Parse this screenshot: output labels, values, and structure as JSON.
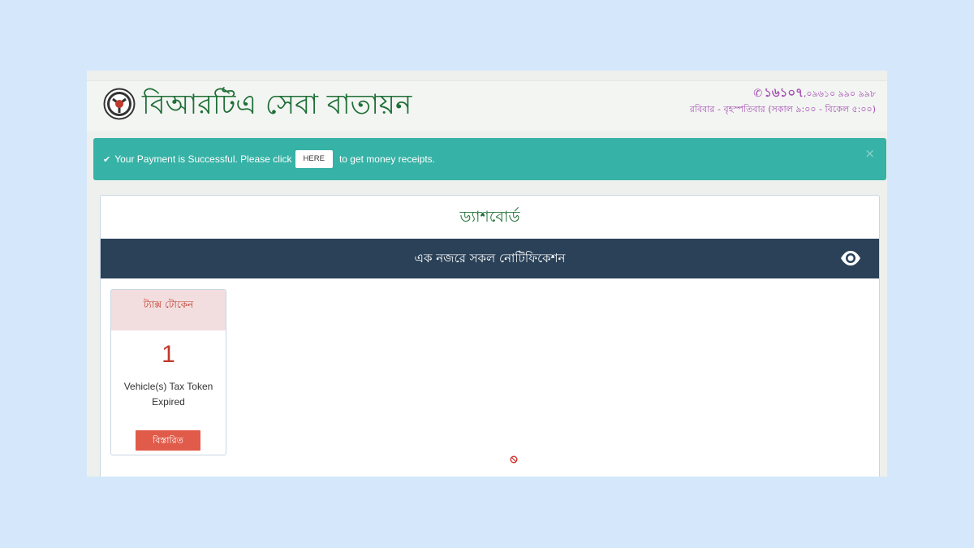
{
  "header": {
    "brand_title": "বিআরটিএ সেবা বাতায়ন",
    "hotline": "১৬১০৭",
    "hotline_alt": ",০৯৬১০ ৯৯০ ৯৯৮",
    "hours": "রবিবার - বৃহস্পতিবার (সকাল ৯:০০ - বিকেল ৫:০০)",
    "logo_icon": "brta-logo-icon",
    "phone_icon": "phone-icon"
  },
  "alert": {
    "message_before": "Your Payment is Successful. Please click",
    "here_label": "HERE",
    "message_after": "to get money receipts.",
    "check_icon": "check-icon",
    "close_label": "×",
    "color": "#36b2a6"
  },
  "dashboard": {
    "title": "ড্যাশবোর্ড",
    "notification_bar": "এক নজরে সকল নোটিফিকেশন",
    "bar_color": "#2a4158",
    "eye_icon": "eye-icon"
  },
  "card": {
    "header": "ট্যাক্স টোকেন",
    "count": "1",
    "description": "Vehicle(s) Tax Token Expired",
    "details_label": "বিস্তারিত",
    "accent": "#e05b4a"
  }
}
